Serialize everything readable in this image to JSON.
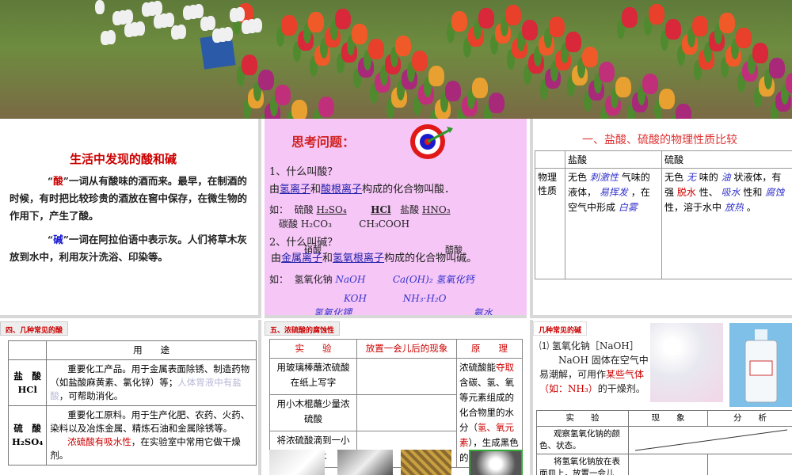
{
  "panel1": {
    "title": "生活中发现的酸和碱",
    "para1_pre": "“",
    "para1_key": "酸",
    "para1_rest": "”一词从有酸味的酒而来。最早，在制酒的时候，有时把比较珍贵的酒放在窖中保存，在微生物的作用下，产生了酸。",
    "para2_pre": "“",
    "para2_key": "碱",
    "para2_rest": "”一词在阿拉伯语中表示灰。人们将草木灰放到水中，利用灰汁洗浴、印染等。"
  },
  "panel2": {
    "title": "思考问题：",
    "q1": "1、什么叫酸？",
    "a1_pre": "由",
    "a1_h": "氢离子",
    "a1_mid": "和",
    "a1_acid": "酸根离子",
    "a1_post": "构成的化合物叫酸．",
    "ex_label": "如：",
    "acid_sulfuric_label": "硫酸",
    "acid_sulfuric": "H₂SO₄",
    "acid_hcl": "HCl",
    "acid_nitric_label": "盐酸",
    "acid_nitric": "HNO₃",
    "acid_carbonic_label": "碳酸",
    "acid_carbonic": "H₂CO₃",
    "acid_acetic": "CH₃COOH",
    "q2": "2、什么叫碱？",
    "a2_pre": "由",
    "a2_metal": "金属离子",
    "a2_mid": "和",
    "a2_oh": "氢氧根离子",
    "a2_post": "构成的化合物叫碱。",
    "overlap1": "硝酸",
    "overlap2": "醋酸",
    "ex2_label": "如：",
    "base_naoh_label": "氢氧化钠",
    "base_naoh": "NaOH",
    "base_caoh": "Ca(OH)₂",
    "base_caoh_label": "氢氧化钙",
    "base_koh": "KOH",
    "base_nh3": "NH₃·H₂O",
    "base_koh_label": "氢氧化钾",
    "base_nh3_label": "氨水"
  },
  "panel3": {
    "title": "一、盐酸、硫酸的物理性质比较",
    "col1": "盐酸",
    "col2": "硫酸",
    "row_label": "物理性质",
    "hcl_desc": "无色 刺激性 气味的液体，易挥发，在空气中形成白雾",
    "hcl_1": "无色",
    "hcl_h1": "刺激性",
    "hcl_2": "气味的液体，",
    "hcl_h2": "易挥发",
    "hcl_3": "，在空气中形成",
    "hcl_h3": "白雾",
    "h2so4_1": "无色",
    "h2so4_h1": "无",
    "h2so4_2": "味的",
    "h2so4_h2": "油",
    "h2so4_3": "状液体，有强",
    "h2so4_h3": "脱水",
    "h2so4_4": "性、",
    "h2so4_h4": "吸水",
    "h2so4_5": "性和",
    "h2so4_h5": "腐蚀",
    "h2so4_6": "性，溶于水中",
    "h2so4_h6": "放热",
    "h2so4_7": "。"
  },
  "panel4": {
    "label": "四、几种常见的酸",
    "col_use": "用　　途",
    "hcl_name": "盐　酸",
    "hcl_formula": "HCl",
    "hcl_use": "重要化工产品。用于金属表面除锈、制造药物（如盐酸麻黄素、氯化锌）等；",
    "hcl_use_gray": "人体胃液中有盐酸",
    "hcl_use_end": "，可帮助消化。",
    "h2so4_name": "硫　酸",
    "h2so4_formula": "H₂SO₄",
    "h2so4_use": "重要化工原料。用于生产化肥、农药、火药、染料以及冶炼金属、精炼石油和金属除锈等。",
    "h2so4_red": "浓硫酸有吸水性",
    "h2so4_end": "，在实验室中常用它做干燥剂。"
  },
  "panel5": {
    "label": "五、浓硫酸的腐蚀性",
    "h1": "实　　验",
    "h2": "放置一会儿后的现象",
    "h3": "原　　理",
    "r1": "用玻璃棒蘸浓硫酸在纸上写字",
    "r2": "用小木棍蘸少量浓硫酸",
    "r3": "将浓硫酸滴到一小块布上",
    "p_pre": "浓硫酸能",
    "p_red1": "夺取",
    "p_mid": "含碳、氢、氧等元素组成的化合物里的水分（",
    "p_red2": "氢、氧元素",
    "p_end": "），生成黑色的炭和水。"
  },
  "panel6": {
    "label": "几种常见的碱",
    "title": "⑴ 氢氧化钠［NaOH］",
    "body_pre": "NaOH 固体在空气中易潮解，可用作",
    "body_red": "某些气体（如：NH₃）",
    "body_end": "的干燥剂。",
    "h1": "实　　验",
    "h2": "现　　象",
    "h3": "分　　析",
    "r1": "观察氢氧化钠的颜色、状态。",
    "r2": "将氢氧化钠放在表面皿上，放置一会儿"
  }
}
